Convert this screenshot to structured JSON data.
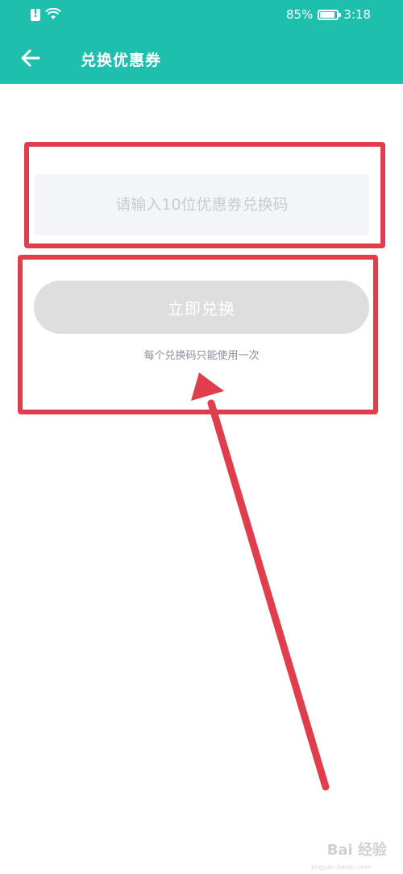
{
  "status_bar": {
    "battery_percent": "85%",
    "time": "3:18",
    "icons": [
      "sim-alert-icon",
      "wifi-icon",
      "battery-icon"
    ]
  },
  "header": {
    "title": "兑换优惠券",
    "back_icon": "arrow-left-icon"
  },
  "form": {
    "code_placeholder": "请输入10位优惠券兑换码",
    "code_value": "",
    "redeem_label": "立即兑换",
    "hint": "每个兑换码只能使用一次"
  },
  "annotations": {
    "highlight_color": "#e23d4c"
  },
  "watermark": {
    "text": "Bai 经验",
    "sub": "jingyan.baidu.com"
  },
  "colors": {
    "brand": "#1fbfae",
    "button_disabled": "#dedede",
    "input_bg": "#f4f5f9"
  }
}
